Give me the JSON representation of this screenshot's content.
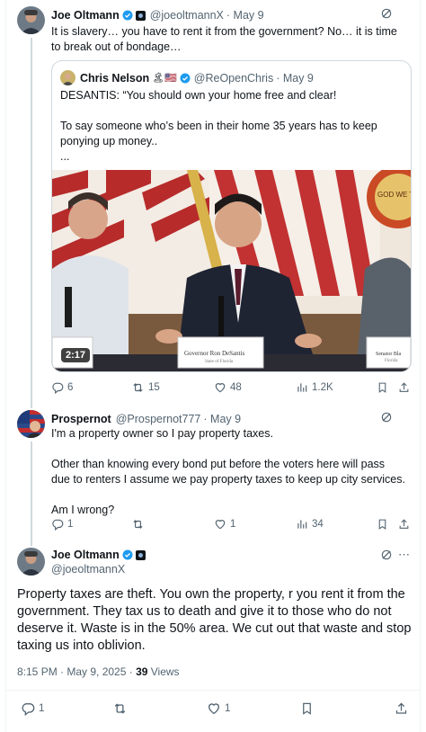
{
  "tweet1": {
    "name": "Joe Oltmann",
    "handle": "@joeoltmannX",
    "time": "· May 9",
    "text": "It is slavery… you have to rent it from the government? No… it is time to break out of bondage…"
  },
  "quote": {
    "name": "Chris Nelson",
    "name_emoji": "🏝🇺🇸",
    "handle": "@ReOpenChris",
    "time": "· May 9",
    "line1": "DESANTIS: “You should own your home free and clear!",
    "line2": "To say someone who’s been in their home 35 years has to keep ponying up money..",
    "line3": "...",
    "duration": "2:17",
    "placard": "Governor Ron DeSantis",
    "placard_sub": "State of Florida",
    "placard_right": "Senator Bla",
    "placard_right_sub": "Florida",
    "seal_text": "GOD WE TRUST"
  },
  "tweet1_actions": {
    "replies": "6",
    "reposts": "15",
    "likes": "48",
    "views": "1.2K"
  },
  "tweet2": {
    "name": "Prospernot",
    "handle": "@Prospernot777",
    "time": "· May 9",
    "p1": "I'm a property owner so I pay property taxes.",
    "p2": "Other than knowing every bond put before the voters here will pass due to renters I assume we pay property taxes to keep up city services.",
    "p3": "Am I wrong?"
  },
  "tweet2_actions": {
    "replies": "1",
    "reposts": "",
    "likes": "1",
    "views": "34"
  },
  "tweet3": {
    "name": "Joe Oltmann",
    "handle": "@joeoltmannX",
    "text": "Property taxes are theft. You own the property, r you rent it from the government. They tax us to death and give it to those who do not deserve it. Waste is in the 50% area. We cut out that waste and stop taxing us into oblivion.",
    "timestamp": "8:15 PM · May 9, 2025 · ",
    "views_count": "39",
    "views_label": " Views"
  },
  "tweet3_actions": {
    "replies": "1",
    "likes": "1"
  },
  "colors": {
    "verified": "#1d9bf0",
    "muted": "#536471",
    "text": "#0f1419",
    "line": "#cfd9de"
  },
  "icons": [
    "reply-icon",
    "repost-icon",
    "like-icon",
    "views-icon",
    "bookmark-icon",
    "share-icon",
    "grok-icon",
    "verified-icon"
  ]
}
